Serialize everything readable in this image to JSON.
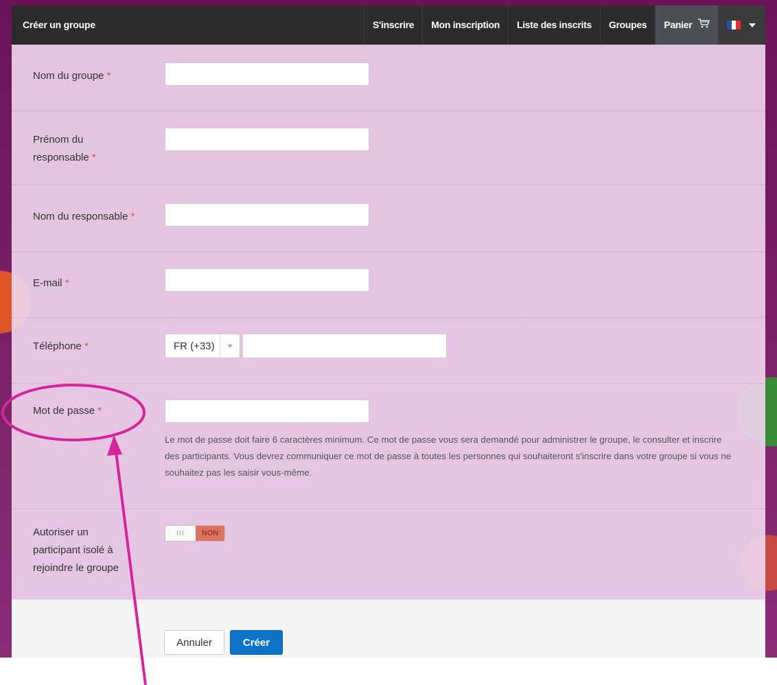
{
  "navbar": {
    "brand": "Créer un groupe",
    "items": [
      {
        "label": "S'inscrire"
      },
      {
        "label": "Mon inscription"
      },
      {
        "label": "Liste des inscrits"
      },
      {
        "label": "Groupes"
      },
      {
        "label": "Panier"
      }
    ]
  },
  "form": {
    "required_mark": "*",
    "group_name": {
      "label": "Nom du groupe",
      "value": ""
    },
    "manager_firstname": {
      "label": "Prénom du responsable",
      "value": ""
    },
    "manager_lastname": {
      "label": "Nom du responsable",
      "value": ""
    },
    "email": {
      "label": "E-mail",
      "value": ""
    },
    "phone": {
      "label": "Téléphone",
      "country": "FR (+33)",
      "value": ""
    },
    "password": {
      "label": "Mot de passe",
      "value": "",
      "help": "Le mot de passe doit faire 6 caractères minimum. Ce mot de passe vous sera demandé pour administrer le groupe, le consulter et inscrire des participants. Vous devrez communiquer ce mot de passe à toutes les personnes qui souhaiteront s'inscrire dans votre groupe si vous ne souhaitez pas les saisir vous-même."
    },
    "allow_isolated": {
      "label": "Autoriser un participant isolé à rejoindre le groupe",
      "handle": "III",
      "state": "NON"
    }
  },
  "buttons": {
    "cancel": "Annuler",
    "create": "Créer"
  },
  "colors": {
    "navbar": "#2b2b2b",
    "primary_button": "#0e72c8",
    "required": "#d9534f",
    "toggle_off": "#d9745f",
    "annotation": "#d6249a"
  },
  "icons": {
    "cart": "cart-icon",
    "flag": "france-flag-icon",
    "caret": "caret-down-icon"
  }
}
